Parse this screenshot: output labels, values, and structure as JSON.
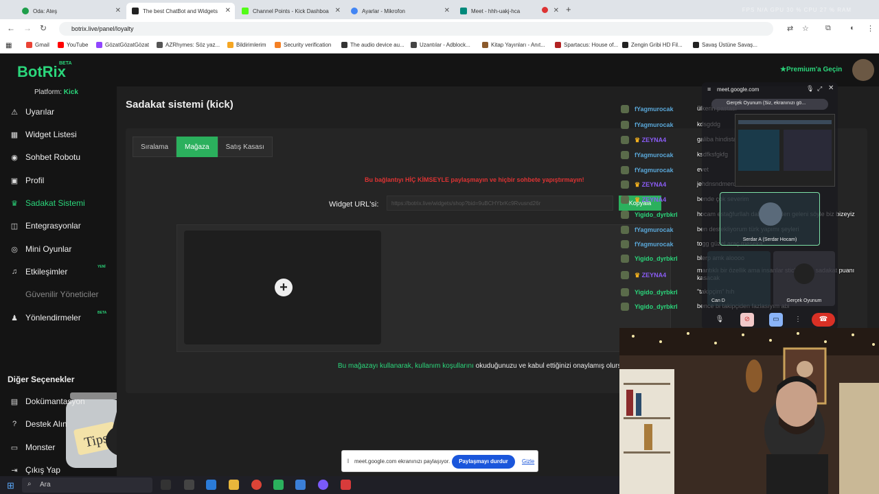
{
  "browser": {
    "tabs": [
      {
        "title": "Oda: Ateş",
        "color": "#1e9e4a"
      },
      {
        "title": "The best ChatBot and Widgets",
        "color": "#222222"
      },
      {
        "title": "Channel Points - Kick Dashboa",
        "color": "#53fc18"
      },
      {
        "title": "Ayarlar - Mikrofon",
        "color": "#4285f4"
      },
      {
        "title": "Meet - hhh-uakj-hca",
        "color": "#00897b"
      }
    ],
    "sys_metrics": "FPS N/A   GPU 30 %   CPU 27 %   RAM",
    "url": "botrix.live/panel/loyalty",
    "bookmarks": [
      {
        "label": "Gmail",
        "color": "#ea4335"
      },
      {
        "label": "YouTube",
        "color": "#ff0000"
      },
      {
        "label": "GözatGözatGözat",
        "color": "#9146ff"
      },
      {
        "label": "AZRhymes: Söz yaz...",
        "color": "#555555"
      },
      {
        "label": "Bildirimlerim",
        "color": "#f5a623"
      },
      {
        "label": "Security verification",
        "color": "#f48024"
      },
      {
        "label": "The audio device au...",
        "color": "#333333"
      },
      {
        "label": "Uzantılar - Adblock...",
        "color": "#444444"
      },
      {
        "label": "Kitap Yayınları - Anıt...",
        "color": "#8b5a2b"
      },
      {
        "label": "Spartacus: House of...",
        "color": "#b22222"
      },
      {
        "label": "Zengin Gribi HD Fil...",
        "color": "#222222"
      },
      {
        "label": "Savaş Üstüne Savaş...",
        "color": "#222222"
      }
    ]
  },
  "site": {
    "logo": "BotRix",
    "beta": "BETA",
    "premium": "Premium'a Geçin",
    "platform_label": "Platform:",
    "platform_value": "Kick",
    "sidebar": [
      {
        "label": "Uyarılar",
        "icon": "⚠"
      },
      {
        "label": "Widget Listesi",
        "icon": "▦"
      },
      {
        "label": "Sohbet Robotu",
        "icon": "◉"
      },
      {
        "label": "Profil",
        "icon": "▣"
      },
      {
        "label": "Sadakat Sistemi",
        "icon": "♛"
      },
      {
        "label": "Entegrasyonlar",
        "icon": "◫"
      },
      {
        "label": "Mini Oyunlar",
        "icon": "◎"
      },
      {
        "label": "Etkileşimler",
        "icon": "♫",
        "badge": "YENİ"
      },
      {
        "label": "Güvenilir Yöneticiler",
        "icon": ""
      },
      {
        "label": "Yönlendirmeler",
        "icon": "♟",
        "badge": "BETA"
      }
    ],
    "section_title": "Diğer Seçenekler",
    "other": [
      {
        "label": "Dokümantasyon",
        "icon": "▤"
      },
      {
        "label": "Destek Alın",
        "icon": "?"
      },
      {
        "label": "Monster",
        "icon": "▭"
      },
      {
        "label": "Çıkış Yap",
        "icon": "⇥"
      }
    ],
    "jar_label": "Tips",
    "page_title": "Sadakat sistemi (kick)",
    "tabs": [
      "Sıralama",
      "Mağaza",
      "Satış Kasası"
    ],
    "warning": "Bu bağlantıyı HİÇ KİMSEYLE paylaşmayın ve hiçbir sohbete yapıştırmayın!",
    "widget_label": "Widget URL'si:",
    "widget_url": "https://botrix.live/widgets/shop?bid=9uBCHYbrKc9Rvusnd26r",
    "copy_label": "Kopyala",
    "terms_link": "Bu mağazayı kullanarak, kullanım koşullarını",
    "terms_rest": " okuduğunuzu ve kabul ettiğinizi onaylamış olursunuz."
  },
  "chat": [
    {
      "user": "fYagmurocak",
      "msg": "ülkerin pastası",
      "color": "#5aa7d8"
    },
    {
      "user": "fYagmurocak",
      "msg": "kdsgddg",
      "color": "#5aa7d8"
    },
    {
      "user": "ZEYNA4",
      "msg": "galiba hindistancevizi seviyor ama emin olamadim",
      "color": "#8a5cf5",
      "crown": true
    },
    {
      "user": "fYagmurocak",
      "msg": "ksdfksfgkfg",
      "color": "#5aa7d8"
    },
    {
      "user": "fYagmurocak",
      "msg": "evet",
      "color": "#5aa7d8"
    },
    {
      "user": "ZEYNA4",
      "msg": "jehdnsndmenxmdms",
      "color": "#8a5cf5",
      "crown": true
    },
    {
      "user": "ZEYNA4",
      "msg": "bende çok severim",
      "color": "#8a5cf5",
      "crown": true
    },
    {
      "user": "Yigido_dyrbkrl",
      "msg": "hocam estağfurllah daha önceden geleni söyle biz bizeyiz",
      "color": "#2bd67b"
    },
    {
      "user": "fYagmurocak",
      "msg": "ben destekliyorum türk yapımı şeyleri",
      "color": "#5aa7d8"
    },
    {
      "user": "fYagmurocak",
      "msg": "togg güzel araç meseka",
      "color": "#5aa7d8"
    },
    {
      "user": "Yigido_dyrbkrl",
      "msg": "blerp amk aloooo",
      "color": "#2bd67b"
    },
    {
      "user": "ZEYNA4",
      "msg": "mantıklı bir özellik ama insanlar sticker için sadakat puanı kasacak",
      "color": "#8a5cf5",
      "crown": true
    },
    {
      "user": "Yigido_dyrbkrl",
      "msg": "\"takipçim\" hıh",
      "color": "#2bd67b"
    },
    {
      "user": "Yigido_dyrbkrl",
      "msg": "bence bi takipçiden fazlasıyım abi",
      "color": "#2bd67b"
    }
  ],
  "meet": {
    "title": "meet.google.com",
    "share_label": "Gerçek Oyunum (Siz, ekranınızı gö...",
    "tile1": "Serdar A (Serdar Hocam)",
    "tile2": "Can D",
    "tile3": "Gerçek Oyunum"
  },
  "share_bar": {
    "text": "meet.google.com ekranınızı paylaşıyor.",
    "stop": "Paylaşmayı durdur",
    "hide": "Gizle"
  },
  "taskbar": {
    "search": "Ara"
  }
}
